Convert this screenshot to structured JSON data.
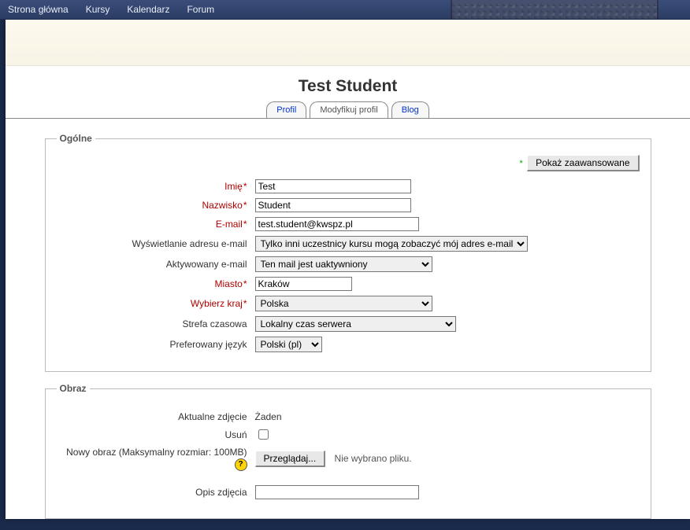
{
  "nav": {
    "items": [
      "Strona główna",
      "Kursy",
      "Kalendarz",
      "Forum"
    ]
  },
  "page_title": "Test Student",
  "tabs": {
    "profile": "Profil",
    "edit": "Modyfikuj profil",
    "blog": "Blog"
  },
  "advanced_button": "Pokaż zaawansowane",
  "general": {
    "legend": "Ogólne",
    "firstname_label": "Imię",
    "firstname_value": "Test",
    "lastname_label": "Nazwisko",
    "lastname_value": "Student",
    "email_label": "E-mail",
    "email_value": "test.student@kwspz.pl",
    "emaildisplay_label": "Wyświetlanie adresu e-mail",
    "emaildisplay_value": "Tylko inni uczestnicy kursu mogą zobaczyć mój adres e-mail",
    "emailactive_label": "Aktywowany e-mail",
    "emailactive_value": "Ten mail jest uaktywniony",
    "city_label": "Miasto",
    "city_value": "Kraków",
    "country_label": "Wybierz kraj",
    "country_value": "Polska",
    "timezone_label": "Strefa czasowa",
    "timezone_value": "Lokalny czas serwera",
    "lang_label": "Preferowany język",
    "lang_value": "Polski (pl)"
  },
  "image": {
    "legend": "Obraz",
    "current_label": "Aktualne zdjęcie",
    "current_value": "Żaden",
    "delete_label": "Usuń",
    "new_label": "Nowy obraz (Maksymalny rozmiar: 100MB)",
    "browse_button": "Przeglądaj...",
    "no_file": "Nie wybrano pliku.",
    "desc_label": "Opis zdjęcia",
    "desc_value": ""
  }
}
